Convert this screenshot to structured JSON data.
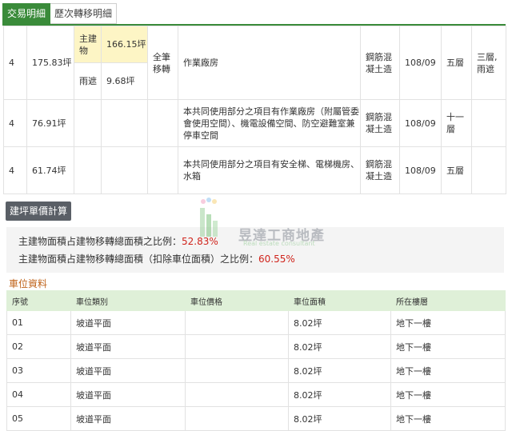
{
  "tabs": [
    {
      "label": "交易明細",
      "active": true
    },
    {
      "label": "歷次轉移明細",
      "active": false
    }
  ],
  "buildings": {
    "row1": {
      "floor": "4",
      "area": "175.83坪",
      "sub1_label": "主建物",
      "sub1_value": "166.15坪",
      "sub2_label": "雨遮",
      "sub2_value": "9.68坪",
      "share": "全筆移轉",
      "usage": "作業廠房",
      "material": "鋼筋混凝土造",
      "date": "108/09",
      "total_floors": "五層",
      "floor_moved": "三層,雨遮"
    },
    "row2": {
      "floor": "4",
      "area": "76.91坪",
      "usage": "本共同使用部分之項目有作業廠房（附屬管委會使用空間）、機電設備空間、防空避難室兼停車空間",
      "material": "鋼筋混凝土造",
      "date": "108/09",
      "total_floors": "十一層"
    },
    "row3": {
      "floor": "4",
      "area": "61.74坪",
      "usage": "本共同使用部分之項目有安全梯、電梯機房、水箱",
      "material": "鋼筋混凝土造",
      "date": "108/09",
      "total_floors": "五層"
    }
  },
  "calc_button": "建坪單價計算",
  "ratios": {
    "line1_label": "主建物面積占建物移轉總面積之比例：",
    "line1_value": "52.83%",
    "line2_label": "主建物面積占建物移轉總面積（扣除車位面積）之比例：",
    "line2_value": "60.55%"
  },
  "watermark": {
    "name": "昱達工商地產",
    "sub": "Real estate consultant"
  },
  "parking": {
    "title": "車位資料",
    "headers": [
      "序號",
      "車位類別",
      "車位價格",
      "車位面積",
      "所在樓層"
    ],
    "rows": [
      [
        "01",
        "坡道平面",
        "",
        "8.02坪",
        "地下一樓"
      ],
      [
        "02",
        "坡道平面",
        "",
        "8.02坪",
        "地下一樓"
      ],
      [
        "03",
        "坡道平面",
        "",
        "8.02坪",
        "地下一樓"
      ],
      [
        "04",
        "坡道平面",
        "",
        "8.02坪",
        "地下一樓"
      ],
      [
        "05",
        "坡道平面",
        "",
        "8.02坪",
        "地下一樓"
      ]
    ]
  },
  "colors": {
    "accent": "#3a8b3a",
    "highlight": "#fdf5c5",
    "ratio_value": "#d0241c",
    "parking_title": "#c0641b",
    "table_header": "#dff0d8"
  }
}
